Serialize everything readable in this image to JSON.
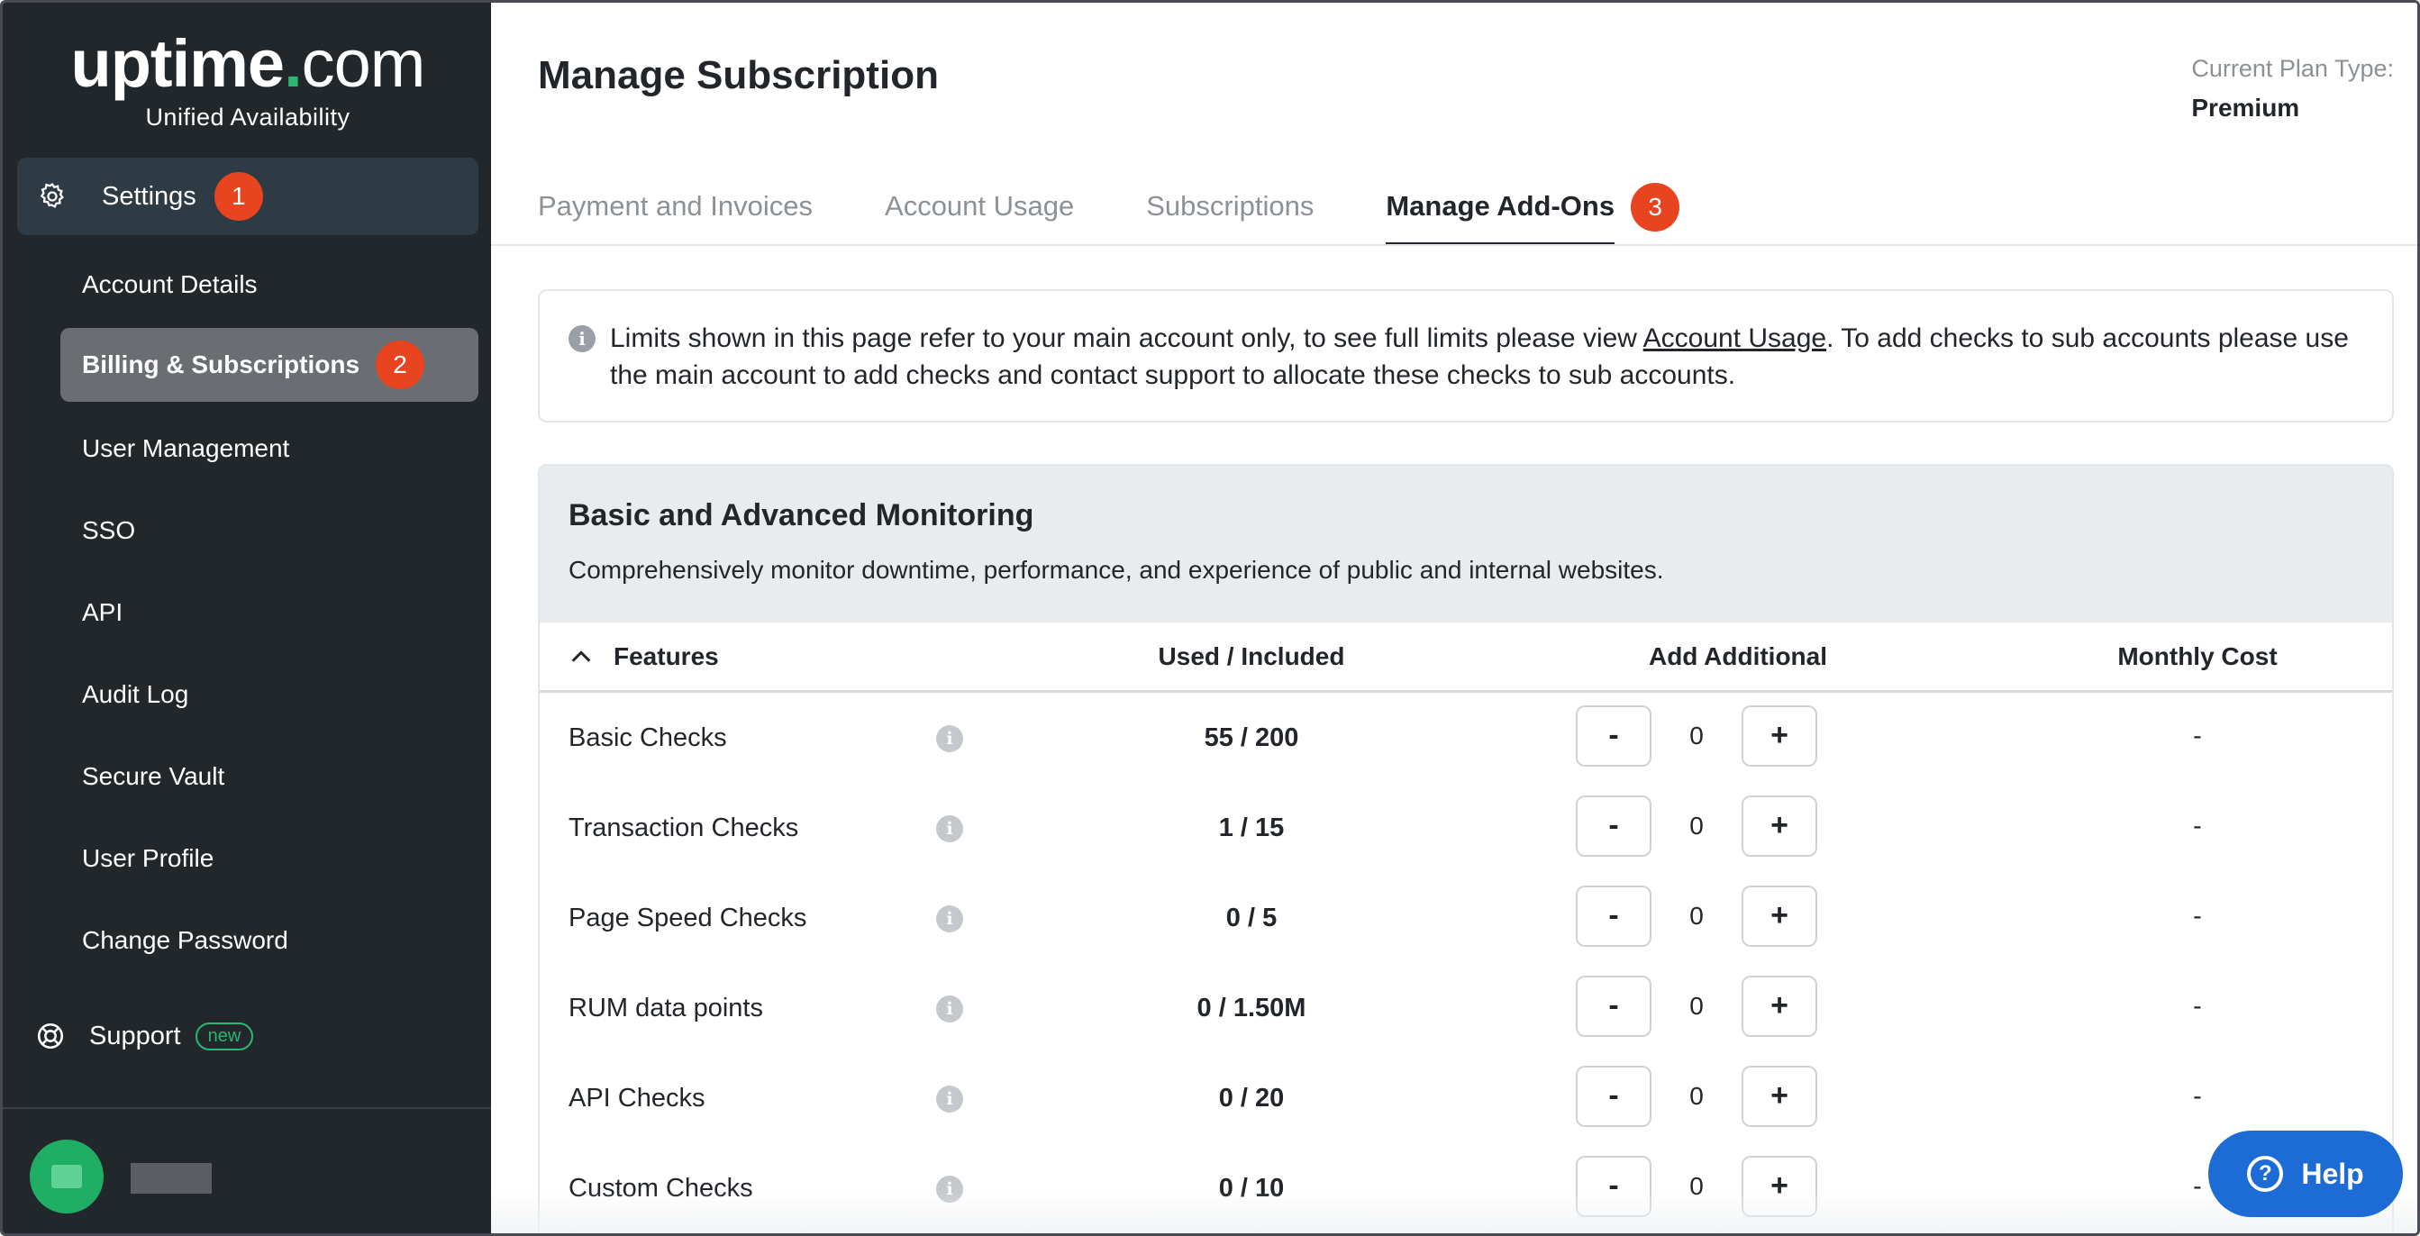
{
  "logo": {
    "main": "uptime",
    "dot": ".",
    "com": "com",
    "sub": "Unified Availability"
  },
  "sidebar": {
    "settings": {
      "label": "Settings",
      "badge": "1"
    },
    "items": [
      {
        "label": "Account Details"
      },
      {
        "label": "Billing & Subscriptions",
        "badge": "2",
        "active": true
      },
      {
        "label": "User Management"
      },
      {
        "label": "SSO"
      },
      {
        "label": "API"
      },
      {
        "label": "Audit Log"
      },
      {
        "label": "Secure Vault"
      },
      {
        "label": "User Profile"
      },
      {
        "label": "Change Password"
      }
    ],
    "support": {
      "label": "Support",
      "pill": "new"
    }
  },
  "header": {
    "title": "Manage Subscription",
    "plan_label": "Current Plan Type:",
    "plan_value": "Premium"
  },
  "tabs": [
    {
      "label": "Payment and Invoices"
    },
    {
      "label": "Account Usage"
    },
    {
      "label": "Subscriptions"
    },
    {
      "label": "Manage Add-Ons",
      "badge": "3",
      "active": true
    }
  ],
  "info": {
    "icon": "i",
    "text_before": "Limits shown in this page refer to your main account only, to see full limits please view ",
    "link": "Account Usage",
    "text_after": ". To add checks to sub accounts please use the main account to add checks and contact support to allocate these checks to sub accounts."
  },
  "section": {
    "title": "Basic and Advanced Monitoring",
    "description": "Comprehensively monitor downtime, performance, and experience of public and internal websites.",
    "columns": {
      "features": "Features",
      "used": "Used / Included",
      "add": "Add Additional",
      "cost": "Monthly Cost"
    },
    "rows": [
      {
        "name": "Basic Checks",
        "used": "55 / 200",
        "add": "0",
        "cost": "-"
      },
      {
        "name": "Transaction Checks",
        "used": "1 / 15",
        "add": "0",
        "cost": "-"
      },
      {
        "name": "Page Speed Checks",
        "used": "0 / 5",
        "add": "0",
        "cost": "-"
      },
      {
        "name": "RUM data points",
        "used": "0 / 1.50M",
        "add": "0",
        "cost": "-"
      },
      {
        "name": "API Checks",
        "used": "0 / 20",
        "add": "0",
        "cost": "-"
      },
      {
        "name": "Custom Checks",
        "used": "0 / 10",
        "add": "0",
        "cost": "-"
      }
    ],
    "minus_label": "-",
    "plus_label": "+",
    "row_info_icon": "i"
  },
  "help": {
    "icon": "?",
    "label": "Help"
  },
  "colors": {
    "sidebar_bg": "#22272b",
    "accent_badge": "#e8441f",
    "brand_green": "#2bb673",
    "help_blue": "#1d6bd4"
  }
}
